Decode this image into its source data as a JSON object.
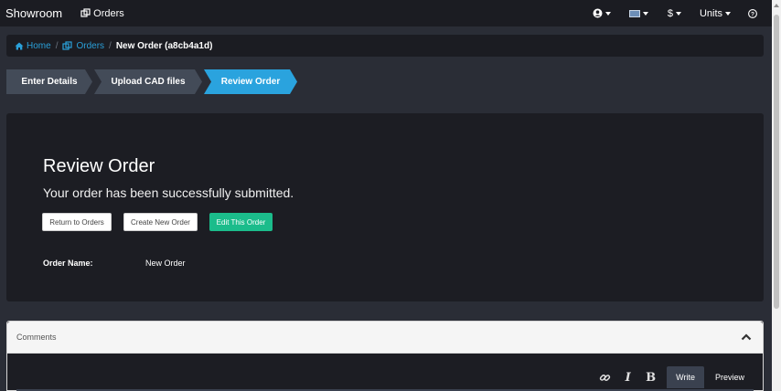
{
  "navbar": {
    "brand": "Showroom",
    "orders_label": "Orders",
    "icons": [
      "user-circle-icon",
      "flag-icon",
      "dollar-icon",
      "help-circle-icon"
    ],
    "currency_label": "$",
    "units_label": "Units"
  },
  "breadcrumb": {
    "home": "Home",
    "orders": "Orders",
    "current": "New Order (a8cb4a1d)",
    "separator": "/"
  },
  "steps": [
    {
      "label": "Enter Details",
      "state": "complete"
    },
    {
      "label": "Upload CAD files",
      "state": "complete"
    },
    {
      "label": "Review Order",
      "state": "active"
    }
  ],
  "review": {
    "title": "Review Order",
    "message": "Your order has been successfully submitted.",
    "buttons": {
      "return": "Return to Orders",
      "create": "Create New Order",
      "edit": "Edit This Order"
    },
    "order_name_label": "Order Name:",
    "order_name_value": "New Order"
  },
  "comments": {
    "title": "Comments",
    "tabs": {
      "write": "Write",
      "preview": "Preview"
    },
    "toolbar_icons": [
      "link-icon",
      "italic-icon",
      "bold-icon"
    ],
    "italic_glyph": "I",
    "bold_glyph": "B"
  },
  "colors": {
    "accent": "#2aa3de",
    "success": "#1bbc8b",
    "navbar": "#1b1c22",
    "panel": "#1c1d23",
    "background": "#2a2d36"
  }
}
